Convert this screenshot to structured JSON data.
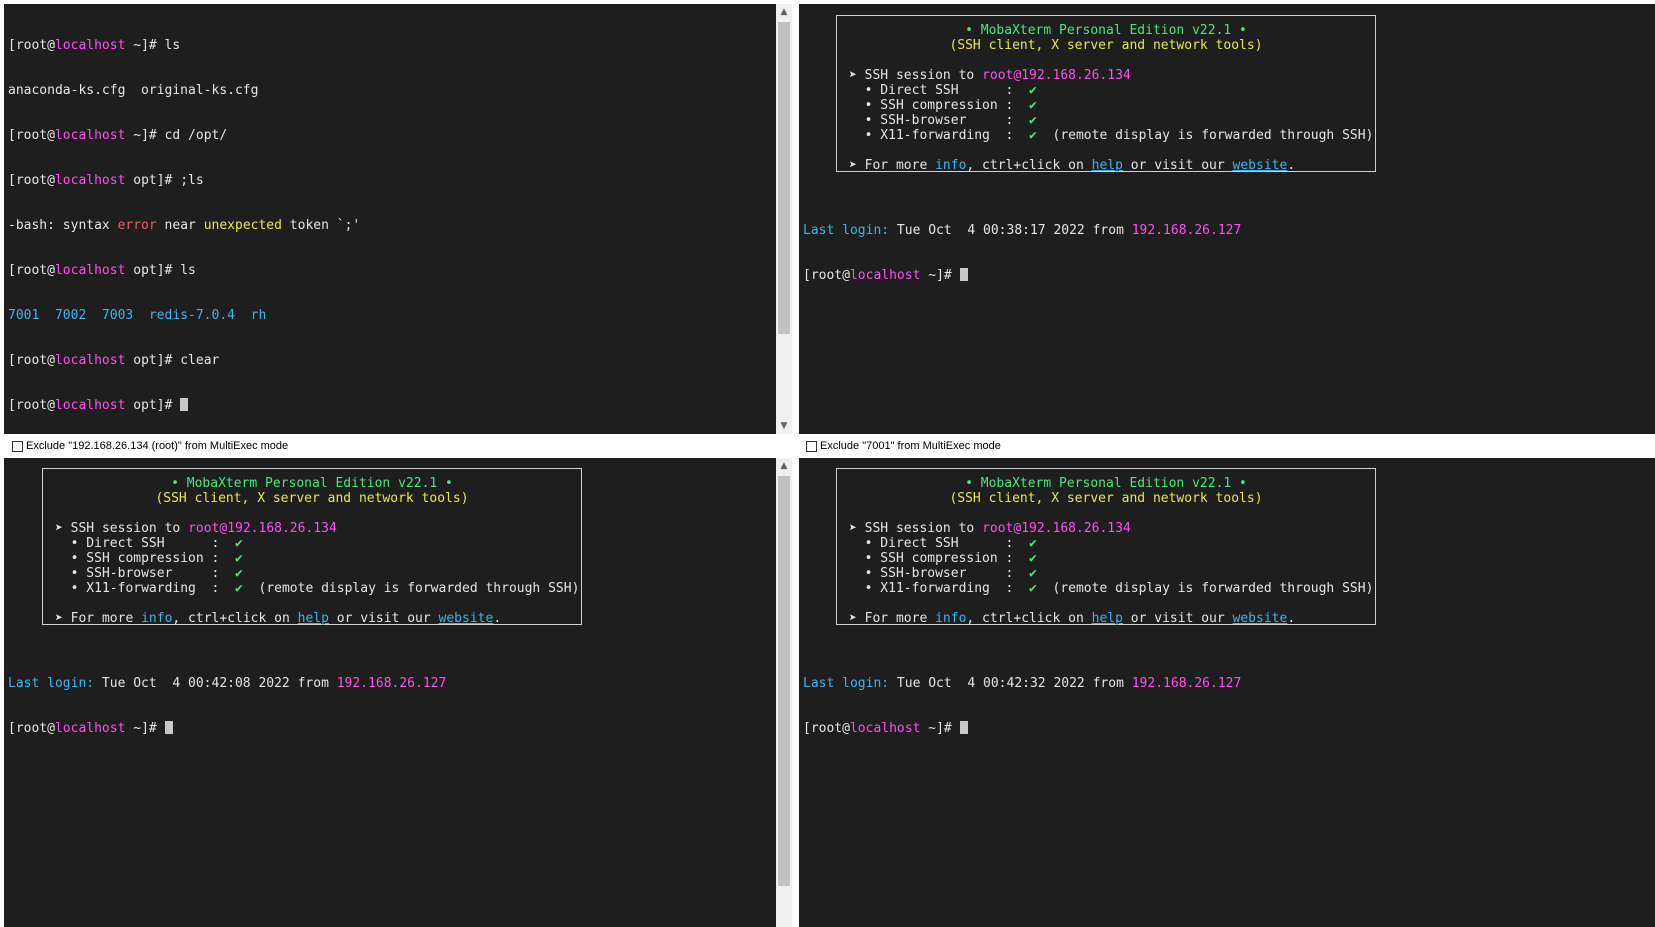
{
  "pane1": {
    "lines": [
      {
        "prefix": "[root@",
        "host": "localhost",
        "suffix": " ~]# ls"
      },
      {
        "text": "anaconda-ks.cfg  original-ks.cfg"
      },
      {
        "prefix": "[root@",
        "host": "localhost",
        "suffix": " ~]# cd /opt/"
      },
      {
        "prefix": "[root@",
        "host": "localhost",
        "suffix": " opt]# ;ls"
      }
    ],
    "bash_error": {
      "a": "-bash: syntax ",
      "b": "error",
      "c": " near ",
      "d": "unexpected",
      "e": " token `;'"
    },
    "ls_line": {
      "prefix": "[root@",
      "host": "localhost",
      "suffix": " opt]# ls"
    },
    "ls_output": "7001  7002  7003  redis-7.0.4  rh",
    "clear_line": {
      "prefix": "[root@",
      "host": "localhost",
      "suffix": " opt]# clear"
    },
    "prompt_line": {
      "prefix": "[root@",
      "host": "localhost",
      "suffix": " opt]# "
    }
  },
  "banner": {
    "title": "• MobaXterm Personal Edition v22.1 •",
    "subtitle": "(SSH client, X server and network tools)",
    "session_prefix": "➤ SSH session to ",
    "session_target": "root@192.168.26.134",
    "direct_ssh": "  • Direct SSH      :  ",
    "ssh_compression": "  • SSH compression :  ",
    "ssh_browser": "  • SSH-browser     :  ",
    "x11": "  • X11-forwarding  :  ",
    "check": "✔",
    "x11_note": "  (remote display is forwarded through SSH)",
    "more_a": "➤ For more ",
    "more_info": "info",
    "more_b": ", ctrl+click on ",
    "more_help": "help",
    "more_c": " or visit our ",
    "more_website": "website",
    "more_d": "."
  },
  "pane2": {
    "last_login_label": "Last login:",
    "last_login_text": " Tue Oct  4 00:38:17 2022 from ",
    "last_login_ip": "192.168.26.127",
    "prompt": {
      "prefix": "[root@",
      "host": "localhost",
      "suffix": " ~]# "
    }
  },
  "pane3": {
    "last_login_label": "Last login:",
    "last_login_text": " Tue Oct  4 00:42:08 2022 from ",
    "last_login_ip": "192.168.26.127",
    "prompt": {
      "prefix": "[root@",
      "host": "localhost",
      "suffix": " ~]# "
    }
  },
  "pane4": {
    "last_login_label": "Last login:",
    "last_login_text": " Tue Oct  4 00:42:32 2022 from ",
    "last_login_ip": "192.168.26.127",
    "prompt": {
      "prefix": "[root@",
      "host": "localhost",
      "suffix": " ~]# "
    }
  },
  "exclude": {
    "left": "Exclude \"192.168.26.134 (root)\" from MultiExec mode",
    "right": "Exclude \"7001\" from MultiExec mode"
  },
  "colors": {
    "terminal_bg": "#1e1e1e",
    "host": "#ff4ef0",
    "green": "#45e87a",
    "yellow": "#e8e84a",
    "cyan": "#39b5f0",
    "red": "#f25a6b"
  }
}
